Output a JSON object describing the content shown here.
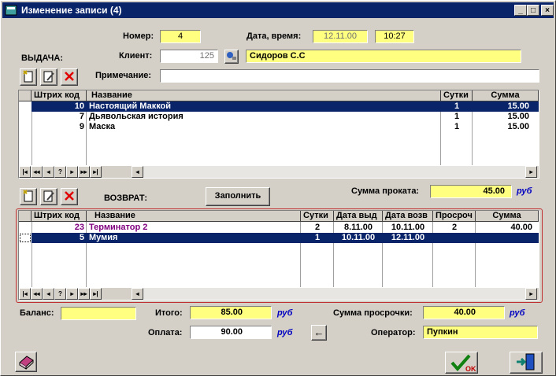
{
  "window": {
    "title": "Изменение записи (4)",
    "btn_min": "_",
    "btn_max": "□",
    "btn_close": "×"
  },
  "header": {
    "number_label": "Номер:",
    "number": "4",
    "datetime_label": "Дата, время:",
    "date": "12.11.00",
    "time": "10:27",
    "client_label": "Клиент:",
    "client_id": "125",
    "client_name": "Сидоров С.С",
    "note_label": "Примечание:",
    "note": ""
  },
  "issue": {
    "section_label": "ВЫДАЧА:",
    "columns": [
      "Штрих код",
      "Название",
      "Сутки",
      "Сумма"
    ],
    "rows": [
      {
        "code": "10",
        "name": "Настоящий Маккой",
        "days": "1",
        "sum": "15.00"
      },
      {
        "code": "7",
        "name": "Дьявольская история",
        "days": "1",
        "sum": "15.00"
      },
      {
        "code": "9",
        "name": "Маска",
        "days": "1",
        "sum": "15.00"
      }
    ],
    "rent_sum_label": "Сумма проката:",
    "rent_sum": "45.00",
    "unit": "руб"
  },
  "nav": {
    "first": "|◂",
    "prev_page": "◂◂",
    "prev": "◂",
    "help": "?",
    "next": "▸",
    "next_page": "▸▸",
    "last": "▸|",
    "scroll_left": "◂",
    "scroll_right": "▸"
  },
  "return": {
    "section_label": "ВОЗВРАТ:",
    "fill_button": "Заполнить",
    "columns": [
      "Штрих код",
      "Название",
      "Сутки",
      "Дата выд",
      "Дата возв",
      "Просроч",
      "Сумма"
    ],
    "rows": [
      {
        "code": "23",
        "name": "Терминатор 2",
        "days": "2",
        "issued": "8.11.00",
        "returned": "10.11.00",
        "overdue": "2",
        "sum": "40.00"
      },
      {
        "code": "5",
        "name": "Мумия",
        "days": "1",
        "issued": "10.11.00",
        "returned": "12.11.00",
        "overdue": "",
        "sum": ""
      }
    ]
  },
  "footer": {
    "balance_label": "Баланс:",
    "balance": "",
    "total_label": "Итого:",
    "total": "85.00",
    "payment_label": "Оплата:",
    "payment": "90.00",
    "overdue_sum_label": "Сумма просрочки:",
    "overdue_sum": "40.00",
    "operator_label": "Оператор:",
    "operator": "Пупкин",
    "unit": "руб",
    "arrow": "←",
    "ok_label": "OK"
  },
  "colors": {
    "title_bar": "#0a246a",
    "field_yellow": "#ffff80",
    "selection": "#0a246a",
    "unit_blue": "#0000c0",
    "return_grid_border": "#c03030",
    "return_row_text": "#800080"
  },
  "icons": [
    "app-icon",
    "add-record-icon",
    "edit-record-icon",
    "delete-record-icon",
    "client-lookup-icon",
    "book-icon",
    "ok-check-icon",
    "exit-door-icon"
  ]
}
